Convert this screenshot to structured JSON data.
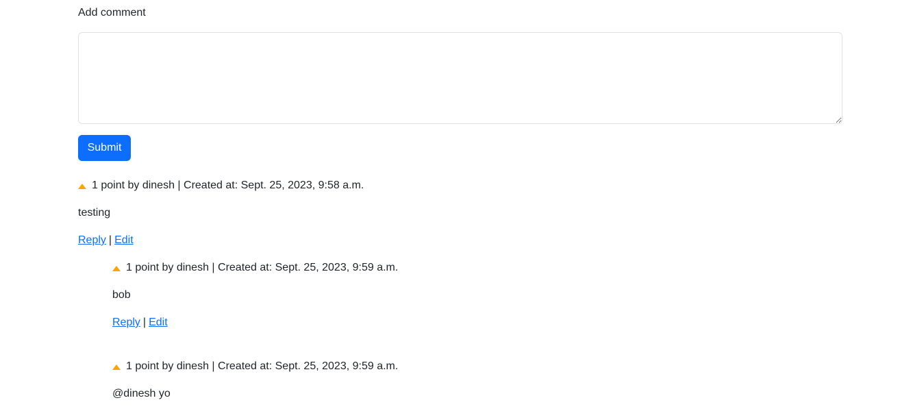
{
  "form": {
    "label": "Add comment",
    "textarea_value": "",
    "submit_label": "Submit"
  },
  "comments": [
    {
      "meta": "1 point by dinesh | Created at: Sept. 25, 2023, 9:58 a.m.",
      "body": "testing",
      "reply_label": "Reply",
      "separator": "|",
      "edit_label": "Edit"
    },
    {
      "meta": "1 point by dinesh | Created at: Sept. 25, 2023, 9:59 a.m.",
      "body": "bob",
      "reply_label": "Reply",
      "separator": "|",
      "edit_label": "Edit"
    },
    {
      "meta": "1 point by dinesh | Created at: Sept. 25, 2023, 9:59 a.m.",
      "body": "@dinesh yo"
    }
  ],
  "colors": {
    "primary": "#0d6efd",
    "upvote": "#ffa500",
    "text": "#212529",
    "border": "#dee2e6"
  },
  "icons": {
    "upvote": "upvote-triangle-icon"
  }
}
